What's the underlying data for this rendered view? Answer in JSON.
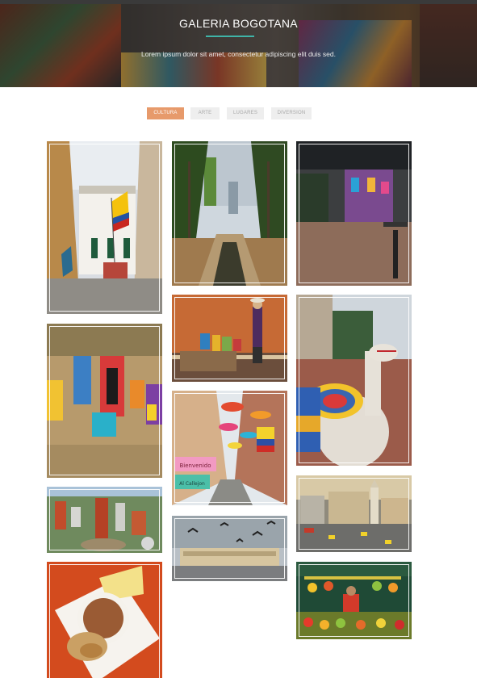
{
  "hero": {
    "title": "GALERIA BOGOTANA",
    "subtitle": "Lorem ipsum dolor sit amet, consectetur adipiscing elit duis sed."
  },
  "filters": [
    {
      "label": "CULTURA",
      "active": true
    },
    {
      "label": "ARTE",
      "active": false
    },
    {
      "label": "LUGARES",
      "active": false
    },
    {
      "label": "DIVERSION",
      "active": false
    }
  ],
  "gallery": {
    "photos": [
      {
        "name": "colonial-street-flag-photo"
      },
      {
        "name": "palm-garden-photo"
      },
      {
        "name": "night-plaza-photo"
      },
      {
        "name": "market-vendor-photo"
      },
      {
        "name": "street-art-wall-photo"
      },
      {
        "name": "llama-with-hat-photo"
      },
      {
        "name": "umbrella-alley-photo"
      },
      {
        "name": "city-aerial-photo"
      },
      {
        "name": "plaza-pigeons-photo"
      },
      {
        "name": "bogota-square-photo"
      },
      {
        "name": "hot-chocolate-photo"
      },
      {
        "name": "fruit-stand-photo"
      }
    ],
    "sign_text": [
      "Bienvenido",
      "Al Callejon"
    ]
  }
}
